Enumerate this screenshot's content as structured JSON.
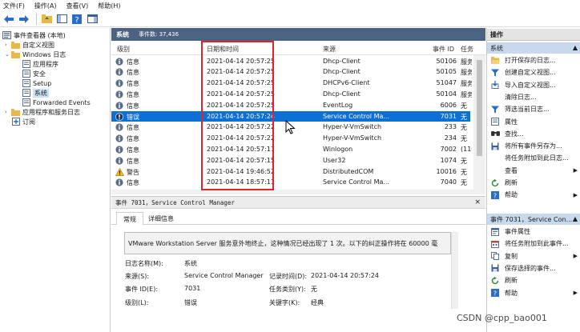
{
  "menu": [
    "文件(F)",
    "操作(A)",
    "查看(V)",
    "帮助(H)"
  ],
  "colors": {
    "header": "#4b6282",
    "selected": "#0e6fd6",
    "highlight_box": "#e0242b",
    "action_sub": "#c9d9ec"
  },
  "tree": {
    "root": "事件查看器 (本地)",
    "custom_views": "自定义视图",
    "windows_logs": "Windows 日志",
    "app": "应用程序",
    "security": "安全",
    "setup": "Setup",
    "system": "系统",
    "forwarded": "Forwarded Events",
    "app_service": "应用程序和服务日志",
    "subscriptions": "订阅"
  },
  "header": {
    "title": "系统",
    "count": "事件数: 37,436"
  },
  "columns": {
    "level": "级别",
    "datetime": "日期和时间",
    "source": "来源",
    "event_id": "事件 ID",
    "task": "任务"
  },
  "events": [
    {
      "level": "信息",
      "icon": "info-icon",
      "datetime": "2021-04-14 20:57:25",
      "source": "Dhcp-Client",
      "id": "50106",
      "task": "服务"
    },
    {
      "level": "信息",
      "icon": "info-icon",
      "datetime": "2021-04-14 20:57:25",
      "source": "Dhcp-Client",
      "id": "50105",
      "task": "服务"
    },
    {
      "level": "信息",
      "icon": "info-icon",
      "datetime": "2021-04-14 20:57:25",
      "source": "DHCPv6-Client",
      "id": "51047",
      "task": "服务"
    },
    {
      "level": "信息",
      "icon": "info-icon",
      "datetime": "2021-04-14 20:57:25",
      "source": "Dhcp-Client",
      "id": "50104",
      "task": "服务"
    },
    {
      "level": "信息",
      "icon": "info-icon",
      "datetime": "2021-04-14 20:57:25",
      "source": "EventLog",
      "id": "6006",
      "task": "无"
    },
    {
      "level": "错误",
      "icon": "error-icon",
      "datetime": "2021-04-14 20:57:24",
      "source": "Service Control Ma...",
      "id": "7031",
      "task": "无"
    },
    {
      "level": "信息",
      "icon": "info-icon",
      "datetime": "2021-04-14 20:57:22",
      "source": "Hyper-V-VmSwitch",
      "id": "233",
      "task": "无"
    },
    {
      "level": "信息",
      "icon": "info-icon",
      "datetime": "2021-04-14 20:57:22",
      "source": "Hyper-V-VmSwitch",
      "id": "234",
      "task": "无"
    },
    {
      "level": "信息",
      "icon": "info-icon",
      "datetime": "2021-04-14 20:57:17",
      "source": "Winlogon",
      "id": "7002",
      "task": "(110"
    },
    {
      "level": "信息",
      "icon": "info-icon",
      "datetime": "2021-04-14 20:57:15",
      "source": "User32",
      "id": "1074",
      "task": "无"
    },
    {
      "level": "警告",
      "icon": "warning-icon",
      "datetime": "2021-04-14 19:46:52",
      "source": "DistributedCOM",
      "id": "10016",
      "task": "无"
    },
    {
      "level": "信息",
      "icon": "info-icon",
      "datetime": "2021-04-14 18:57:11",
      "source": "Service Control Ma...",
      "id": "7040",
      "task": "无"
    }
  ],
  "selected_index": 5,
  "detail": {
    "title": "事件 7031，Service Control Manager",
    "close": "×",
    "tabs": [
      "常规",
      "详细信息"
    ],
    "message": "VMware Workstation Server 服务意外地终止，这种情况已经出现了 1 次。以下的纠正操作将在 60000 毫",
    "log_name_label": "日志名称(M):",
    "log_name": "系统",
    "source_label": "来源(S):",
    "source": "Service Control Manager",
    "logged_label": "记录时间(D):",
    "logged": "2021-04-14 20:57:24",
    "event_id_label": "事件 ID(E):",
    "event_id": "7031",
    "task_label": "任务类别(Y):",
    "task": "无",
    "level_label": "级别(L):",
    "level": "错误",
    "keywords_label": "关键字(K):",
    "keywords": "经典"
  },
  "actions": {
    "title": "操作",
    "section1": "系统",
    "items1": [
      {
        "label": "打开保存的日志...",
        "icon": "folder-open-icon"
      },
      {
        "label": "创建自定义视图...",
        "icon": "filter-icon"
      },
      {
        "label": "导入自定义视图...",
        "icon": "import-icon"
      },
      {
        "label": "清除日志...",
        "icon": "blank-icon"
      },
      {
        "label": "筛选当前日志...",
        "icon": "filter-icon"
      },
      {
        "label": "属性",
        "icon": "properties-icon"
      },
      {
        "label": "查找...",
        "icon": "find-icon"
      },
      {
        "label": "将所有事件另存为...",
        "icon": "save-icon"
      },
      {
        "label": "将任务附加到此日志...",
        "icon": "blank-icon"
      },
      {
        "label": "查看",
        "icon": "blank-icon",
        "submenu": true
      },
      {
        "label": "刷新",
        "icon": "refresh-icon"
      },
      {
        "label": "帮助",
        "icon": "help-icon",
        "submenu": true
      }
    ],
    "section2": "事件 7031，Service Con...",
    "items2": [
      {
        "label": "事件属性",
        "icon": "event-properties-icon"
      },
      {
        "label": "将任务附加到此事件...",
        "icon": "attach-task-icon"
      },
      {
        "label": "复制",
        "icon": "copy-icon",
        "submenu": true
      },
      {
        "label": "保存选择的事件...",
        "icon": "save-icon"
      },
      {
        "label": "刷新",
        "icon": "refresh-icon"
      },
      {
        "label": "帮助",
        "icon": "help-icon",
        "submenu": true
      }
    ]
  },
  "watermark": "CSDN @cpp_bao001"
}
